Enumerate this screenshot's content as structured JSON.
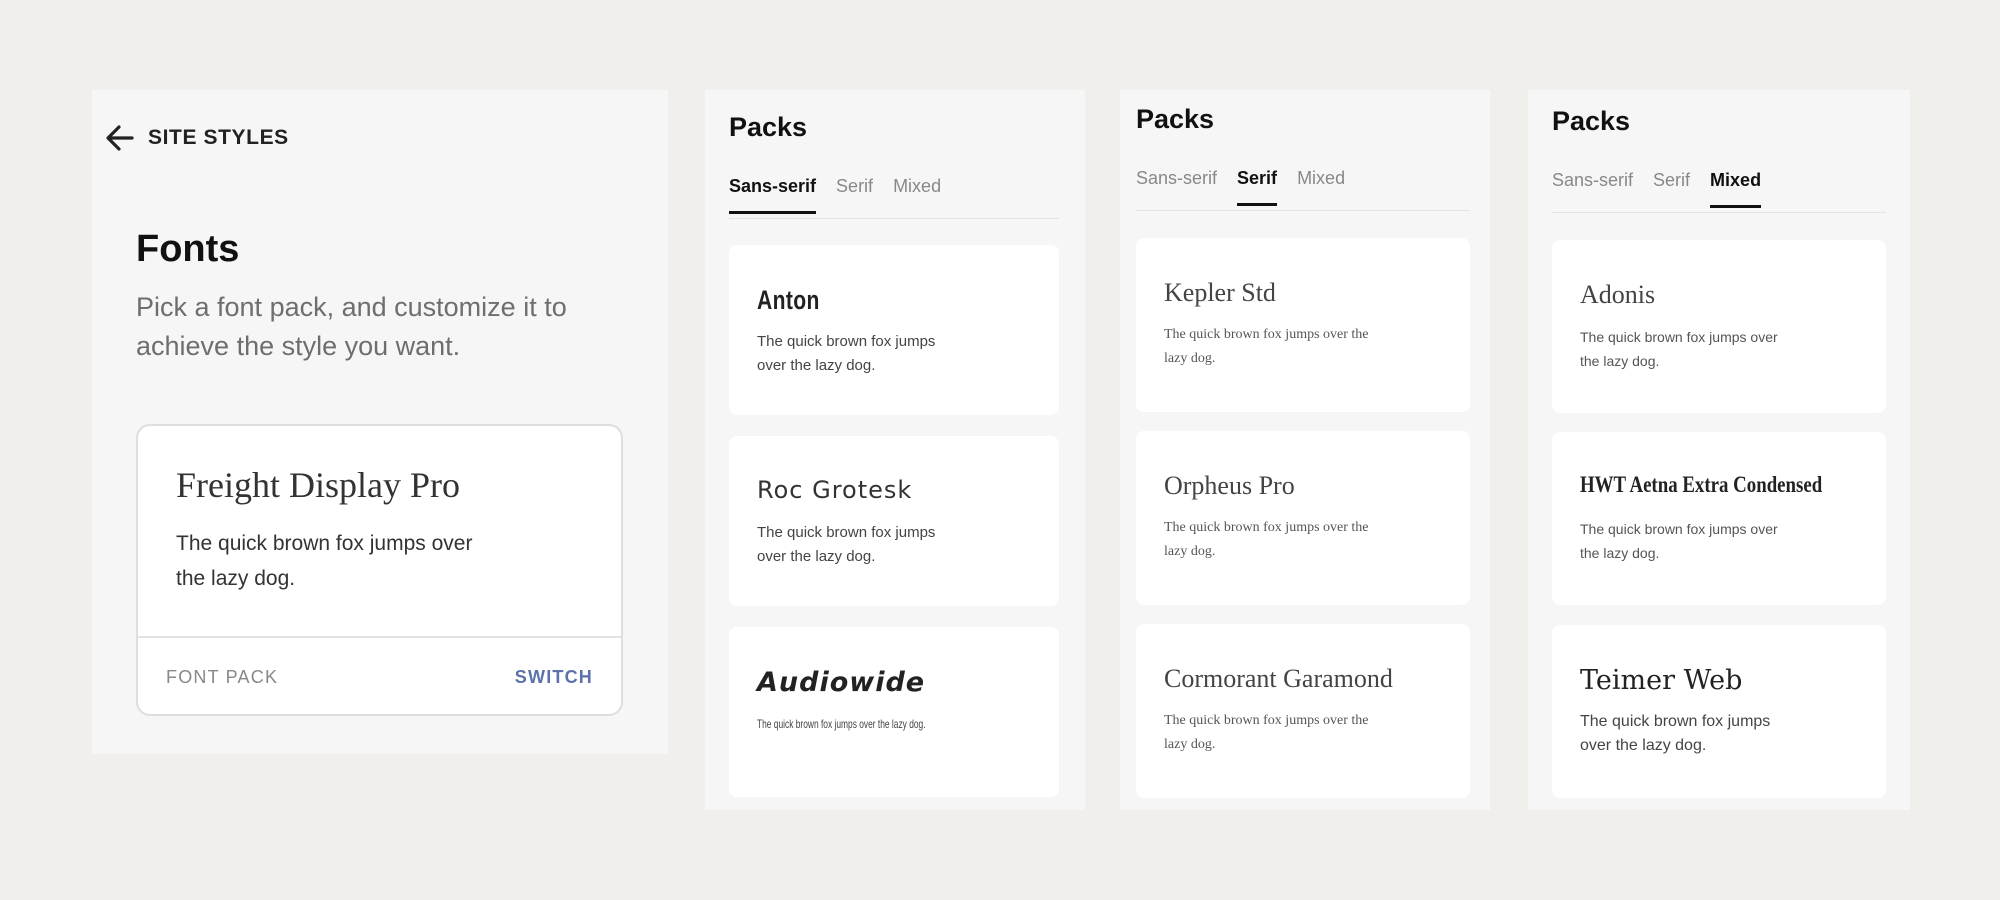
{
  "site_styles": {
    "back_label": "SITE STYLES",
    "title": "Fonts",
    "description": "Pick a font pack, and customize it to achieve the style you want.",
    "current_pack": {
      "font_name": "Freight Display Pro",
      "sample": "The quick brown fox jumps over the lazy dog.",
      "footer_label": "FONT PACK",
      "switch_label": "SWITCH"
    }
  },
  "packs_title": "Packs",
  "tabs": [
    "Sans-serif",
    "Serif",
    "Mixed"
  ],
  "sans_serif_pack": [
    {
      "font_name": "Anton",
      "sample": "The quick brown fox jumps over the lazy dog."
    },
    {
      "font_name": "Roc Grotesk",
      "sample": "The quick brown fox jumps over the lazy dog."
    },
    {
      "font_name": "Audiowide",
      "sample": "The quick brown fox jumps over the lazy dog."
    }
  ],
  "serif_pack": [
    {
      "font_name": "Kepler Std",
      "sample": "The quick brown fox jumps over the lazy dog."
    },
    {
      "font_name": "Orpheus Pro",
      "sample": "The quick brown fox jumps over the lazy dog."
    },
    {
      "font_name": "Cormorant Garamond",
      "sample": "The quick brown fox jumps over the lazy dog."
    }
  ],
  "mixed_pack": [
    {
      "font_name": "Adonis",
      "sample": "The quick brown fox jumps over the lazy dog."
    },
    {
      "font_name": "HWT Aetna Extra Condensed",
      "sample": "The quick brown fox jumps over the lazy dog."
    },
    {
      "font_name": "Teimer Web",
      "sample": "The quick brown fox jumps over the lazy dog."
    }
  ],
  "colors": {
    "background": "#f0efec",
    "panel": "#f6f6f6",
    "card": "#ffffff",
    "switch_accent": "#5b73a8",
    "active_tab": "#111111",
    "inactive_tab": "#888888"
  },
  "icons": {
    "back": "arrow-left-icon"
  }
}
